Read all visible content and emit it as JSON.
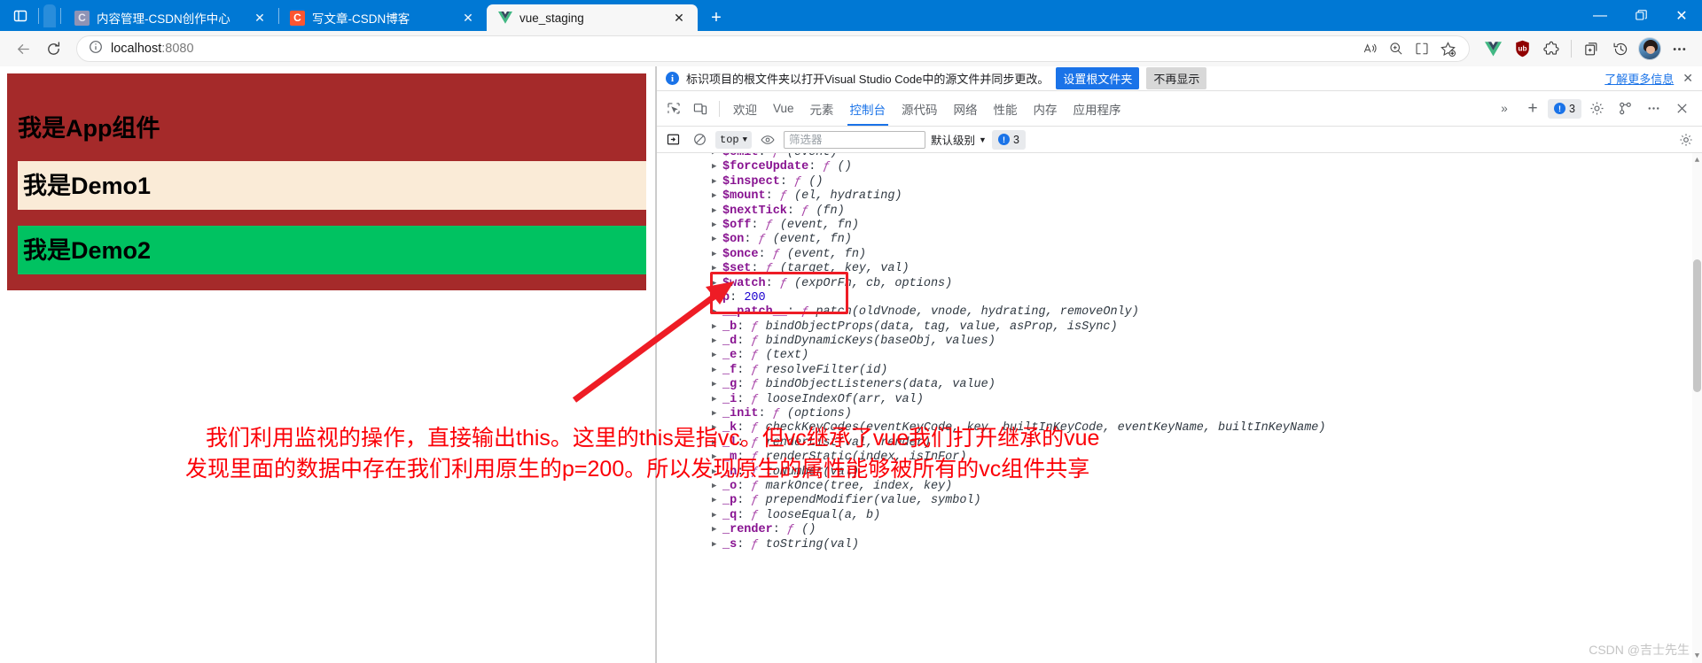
{
  "browser": {
    "tabs": [
      {
        "title": "内容管理-CSDN创作中心",
        "favicon": "csdn-icon",
        "favicon_letter": "C",
        "active": false,
        "close_label": "✕"
      },
      {
        "title": "写文章-CSDN博客",
        "favicon": "csdn-icon",
        "favicon_letter": "C",
        "active": false,
        "close_label": "✕"
      },
      {
        "title": "vue_staging",
        "favicon": "vue-logo-icon",
        "favicon_letter": "V",
        "active": true,
        "close_label": "✕"
      }
    ],
    "new_tab_label": "+",
    "window_controls": {
      "minimize": "—",
      "maximize": "❐",
      "close": "✕"
    },
    "address": {
      "host": "localhost",
      "port": ":8080",
      "info_icon": "info-circle-icon"
    },
    "nav": {
      "back": "←",
      "reload": "↻"
    },
    "toolbar_right_icons": [
      "read-aloud-icon",
      "zoom-icon",
      "split-screen-icon",
      "add-favorite-icon",
      "vue-devtools-extension-icon",
      "ublock-extension-icon",
      "puzzle-extension-icon",
      "collections-icon",
      "history-icon",
      "profile-avatar",
      "settings-more-icon"
    ]
  },
  "page": {
    "app_title": "我是App组件",
    "demo1_title": "我是Demo1",
    "demo2_title": "我是Demo2",
    "colors": {
      "app_bg": "#a52a2a",
      "demo1_bg": "#faebd7",
      "demo2_bg": "#00c261"
    }
  },
  "annotation": {
    "color": "#fb0007",
    "line1": "我们利用监视的操作，直接输出this。这里的this是指vc。但vc继承了vue我们打开继承的vue",
    "line2": "发现里面的数据中存在我们利用原生的p=200。所以发现原生的属性能够被所有的vc组件共享"
  },
  "devtools": {
    "banner": {
      "icon": "info-icon",
      "text": "标识项目的根文件夹以打开Visual Studio Code中的源文件并同步更改。",
      "primary_button": "设置根文件夹",
      "secondary_button": "不再显示",
      "learn_more": "了解更多信息",
      "close": "✕"
    },
    "tabbar": {
      "left_icons": [
        "inspect-element-icon",
        "device-toolbar-icon"
      ],
      "tabs": [
        {
          "label": "欢迎",
          "selected": false
        },
        {
          "label": "Vue",
          "selected": false
        },
        {
          "label": "元素",
          "selected": false
        },
        {
          "label": "控制台",
          "selected": true
        },
        {
          "label": "源代码",
          "selected": false
        },
        {
          "label": "网络",
          "selected": false
        },
        {
          "label": "性能",
          "selected": false
        },
        {
          "label": "内存",
          "selected": false
        },
        {
          "label": "应用程序",
          "selected": false
        }
      ],
      "more_tabs": "»",
      "add_tab": "+",
      "issues_count": "3",
      "right_icons": [
        "settings-gear-icon",
        "customize-icon",
        "more-options-icon",
        "close-devtools-icon"
      ]
    },
    "filterbar": {
      "sidebar_icon": "console-sidebar-icon",
      "clear_icon": "clear-console-icon",
      "context": "top",
      "eye_icon": "live-expression-icon",
      "filter_placeholder": "筛选器",
      "filter_value": "",
      "level": "默认级别",
      "issues_count": "3",
      "settings_icon": "console-settings-icon"
    },
    "console_lines": [
      {
        "tri": true,
        "key": "$emit",
        "fn": "ƒ",
        "sig": "(event)",
        "cut": true
      },
      {
        "tri": true,
        "key": "$forceUpdate",
        "fn": "ƒ",
        "sig": "()"
      },
      {
        "tri": true,
        "key": "$inspect",
        "fn": "ƒ",
        "sig": "()"
      },
      {
        "tri": true,
        "key": "$mount",
        "fn": "ƒ",
        "sig": "(el, hydrating)"
      },
      {
        "tri": true,
        "key": "$nextTick",
        "fn": "ƒ",
        "sig": "(fn)"
      },
      {
        "tri": true,
        "key": "$off",
        "fn": "ƒ",
        "sig": "(event, fn)"
      },
      {
        "tri": true,
        "key": "$on",
        "fn": "ƒ",
        "sig": "(event, fn)"
      },
      {
        "tri": true,
        "key": "$once",
        "fn": "ƒ",
        "sig": "(event, fn)"
      },
      {
        "tri": true,
        "key": "$set",
        "fn": "ƒ",
        "sig": "(target, key, val)"
      },
      {
        "tri": true,
        "key": "$watch",
        "fn": "ƒ",
        "sig": "(expOrFn, cb, options)"
      },
      {
        "tri": false,
        "key": "p",
        "fn": "",
        "sig": "",
        "value": "200"
      },
      {
        "tri": true,
        "key": "__patch__",
        "fn": "ƒ",
        "sig": "patch(oldVnode, vnode, hydrating, removeOnly)"
      },
      {
        "tri": true,
        "key": "_b",
        "fn": "ƒ",
        "sig": "bindObjectProps(data, tag, value, asProp, isSync)"
      },
      {
        "tri": true,
        "key": "_d",
        "fn": "ƒ",
        "sig": "bindDynamicKeys(baseObj, values)"
      },
      {
        "tri": true,
        "key": "_e",
        "fn": "ƒ",
        "sig": "(text)"
      },
      {
        "tri": true,
        "key": "_f",
        "fn": "ƒ",
        "sig": "resolveFilter(id)"
      },
      {
        "tri": true,
        "key": "_g",
        "fn": "ƒ",
        "sig": "bindObjectListeners(data, value)"
      },
      {
        "tri": true,
        "key": "_i",
        "fn": "ƒ",
        "sig": "looseIndexOf(arr, val)"
      },
      {
        "tri": true,
        "key": "_init",
        "fn": "ƒ",
        "sig": "(options)"
      },
      {
        "tri": true,
        "key": "_k",
        "fn": "ƒ",
        "sig": "checkKeyCodes(eventKeyCode, key, builtInKeyCode, eventKeyName, builtInKeyName)"
      },
      {
        "tri": true,
        "key": "_l",
        "fn": "ƒ",
        "sig": "renderList(val, render)"
      },
      {
        "tri": true,
        "key": "_m",
        "fn": "ƒ",
        "sig": "renderStatic(index, isInFor)"
      },
      {
        "tri": true,
        "key": "_n",
        "fn": "ƒ",
        "sig": "toNumber(val)"
      },
      {
        "tri": true,
        "key": "_o",
        "fn": "ƒ",
        "sig": "markOnce(tree, index, key)"
      },
      {
        "tri": true,
        "key": "_p",
        "fn": "ƒ",
        "sig": "prependModifier(value, symbol)"
      },
      {
        "tri": true,
        "key": "_q",
        "fn": "ƒ",
        "sig": "looseEqual(a, b)"
      },
      {
        "tri": true,
        "key": "_render",
        "fn": "ƒ",
        "sig": "()"
      },
      {
        "tri": true,
        "key": "_s",
        "fn": "ƒ",
        "sig": "toString(val)",
        "cut": true
      }
    ]
  },
  "watermark": "CSDN @吉士先生"
}
